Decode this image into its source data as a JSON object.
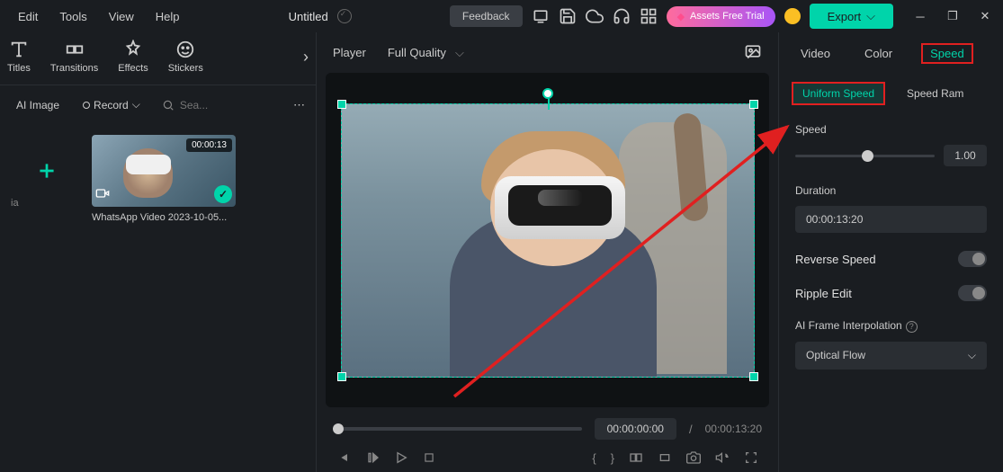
{
  "menu": {
    "edit": "Edit",
    "tools": "Tools",
    "view": "View",
    "help": "Help"
  },
  "document": {
    "title": "Untitled"
  },
  "topbar": {
    "feedback": "Feedback",
    "assets_trial": "Assets Free Trial",
    "export": "Export"
  },
  "tools": {
    "titles": "Titles",
    "transitions": "Transitions",
    "effects": "Effects",
    "stickers": "Stickers"
  },
  "filters": {
    "ai_image": "AI Image",
    "record": "Record",
    "search_placeholder": "Sea..."
  },
  "media": {
    "ia_label": "ia",
    "items": [
      {
        "duration": "00:00:13",
        "name": "WhatsApp Video 2023-10-05..."
      }
    ]
  },
  "player": {
    "label": "Player",
    "quality": "Full Quality",
    "current_time": "00:00:00:00",
    "total_time": "00:00:13:20"
  },
  "properties": {
    "tabs": {
      "video": "Video",
      "color": "Color",
      "speed": "Speed"
    },
    "speed_tabs": {
      "uniform": "Uniform Speed",
      "ramp": "Speed Ram"
    },
    "speed": {
      "label": "Speed",
      "value": "1.00"
    },
    "duration": {
      "label": "Duration",
      "value": "00:00:13:20"
    },
    "reverse": {
      "label": "Reverse Speed"
    },
    "ripple": {
      "label": "Ripple Edit"
    },
    "ai_frame": {
      "label": "AI Frame Interpolation",
      "value": "Optical Flow"
    }
  }
}
